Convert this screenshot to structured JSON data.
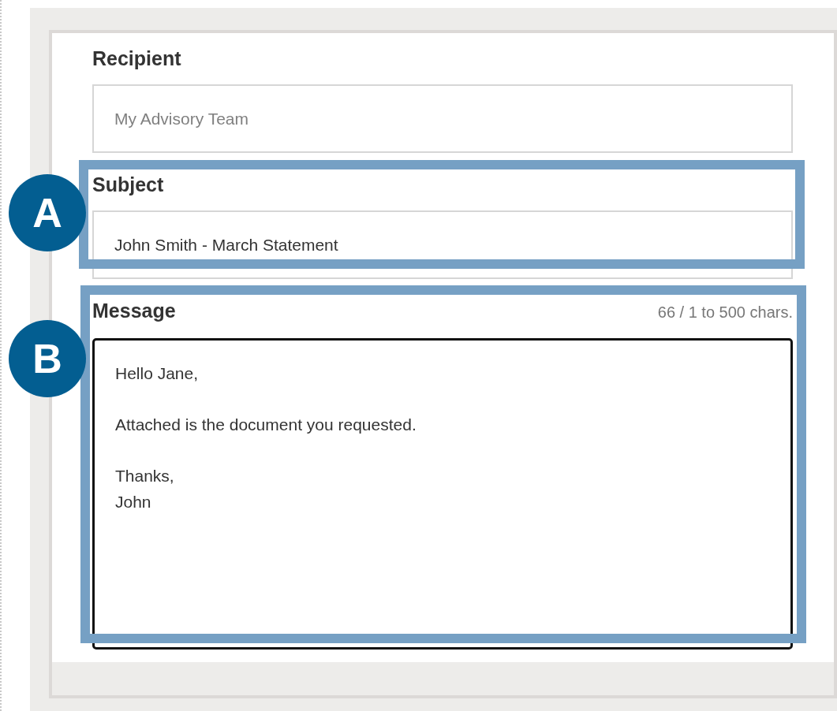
{
  "form": {
    "fields": [
      {
        "label": "Recipient",
        "kind": "input",
        "value": "My Advisory Team",
        "disabled": true
      },
      {
        "label": "Subject",
        "kind": "input",
        "value": "John Smith - March Statement",
        "disabled": false
      },
      {
        "label": "Message",
        "kind": "textarea",
        "counter": "66 / 1 to 500 chars.",
        "value": "Hello Jane,\n\nAttached is the document you requested.\n\nThanks,\nJohn",
        "disabled": false
      }
    ]
  },
  "callouts": [
    {
      "label": "A"
    },
    {
      "label": "B"
    }
  ]
}
